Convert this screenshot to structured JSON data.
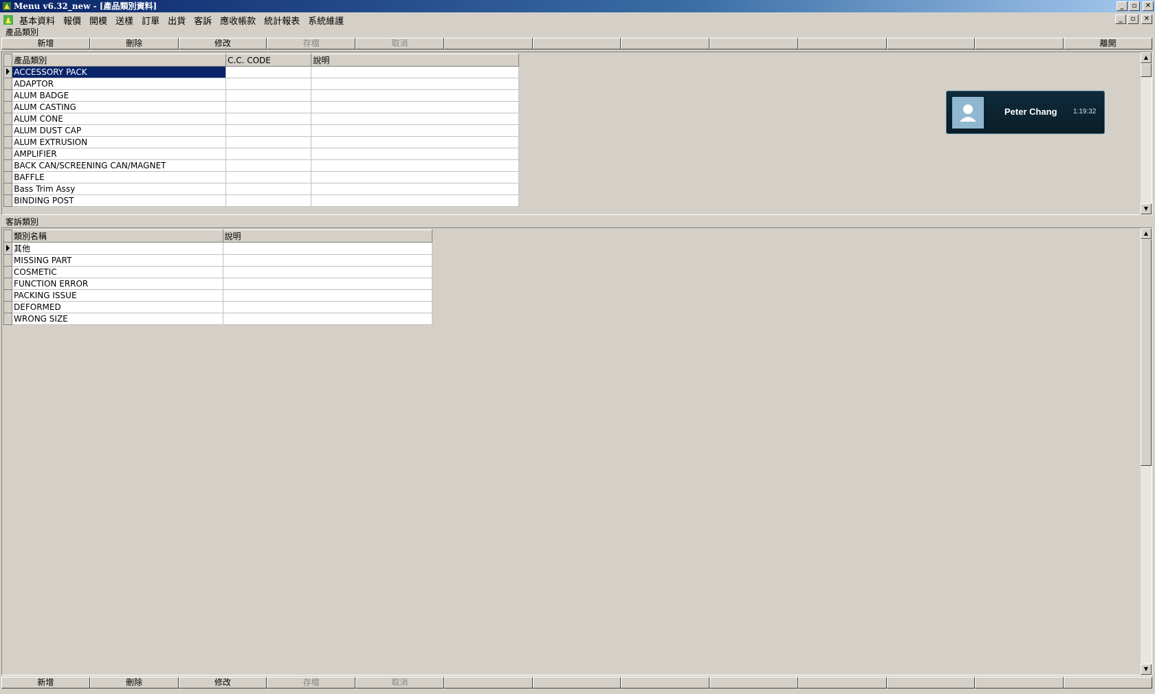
{
  "window": {
    "title": "Menu v6.32_new - [產品類別資料]"
  },
  "menu": {
    "items": [
      "基本資料",
      "報價",
      "開模",
      "送樣",
      "訂單",
      "出貨",
      "客訴",
      "應收帳款",
      "統計報表",
      "系統維護"
    ]
  },
  "section_top": {
    "label": "產品類別",
    "toolbar": {
      "buttons": [
        "新增",
        "刪除",
        "修改",
        "存檔",
        "取消",
        "",
        "",
        "",
        "",
        "",
        "",
        "",
        "離開"
      ],
      "disabled": [
        false,
        false,
        false,
        true,
        true,
        false,
        false,
        false,
        false,
        false,
        false,
        false,
        false
      ]
    },
    "grid": {
      "columns": [
        "產品類別",
        "C.C. CODE",
        "說明"
      ],
      "rows": [
        [
          "ACCESSORY PACK",
          "",
          ""
        ],
        [
          "ADAPTOR",
          "",
          ""
        ],
        [
          "ALUM BADGE",
          "",
          ""
        ],
        [
          "ALUM CASTING",
          "",
          ""
        ],
        [
          "ALUM CONE",
          "",
          ""
        ],
        [
          "ALUM DUST CAP",
          "",
          ""
        ],
        [
          "ALUM EXTRUSION",
          "",
          ""
        ],
        [
          "AMPLIFIER",
          "",
          ""
        ],
        [
          "BACK CAN/SCREENING CAN/MAGNET",
          "",
          ""
        ],
        [
          "BAFFLE",
          "",
          ""
        ],
        [
          "Bass Trim Assy",
          "",
          ""
        ],
        [
          "BINDING POST",
          "",
          ""
        ]
      ],
      "selected_row": 0
    }
  },
  "section_bottom": {
    "label": "客訴類別",
    "grid": {
      "columns": [
        "類別名稱",
        "說明"
      ],
      "rows": [
        [
          "其他",
          ""
        ],
        [
          "MISSING PART",
          ""
        ],
        [
          "COSMETIC",
          ""
        ],
        [
          "FUNCTION ERROR",
          ""
        ],
        [
          "PACKING ISSUE",
          ""
        ],
        [
          "DEFORMED",
          ""
        ],
        [
          "WRONG SIZE",
          ""
        ]
      ],
      "selected_row": 0
    },
    "toolbar": {
      "buttons": [
        "新增",
        "刪除",
        "修改",
        "存檔",
        "取消",
        "",
        "",
        "",
        "",
        "",
        "",
        "",
        ""
      ],
      "disabled": [
        false,
        false,
        false,
        true,
        true,
        false,
        false,
        false,
        false,
        false,
        false,
        false,
        false
      ]
    }
  },
  "notification": {
    "name": "Peter Chang",
    "time": "1:19:32"
  },
  "colors": {
    "titlebar_start": "#0a246a",
    "selection": "#0a246a",
    "face": "#d4d0c8"
  },
  "icons": [
    "app-icon",
    "minimize-icon",
    "restore-icon",
    "close-icon",
    "user-avatar-icon",
    "row-indicator-icon",
    "scroll-up-icon",
    "scroll-down-icon"
  ]
}
